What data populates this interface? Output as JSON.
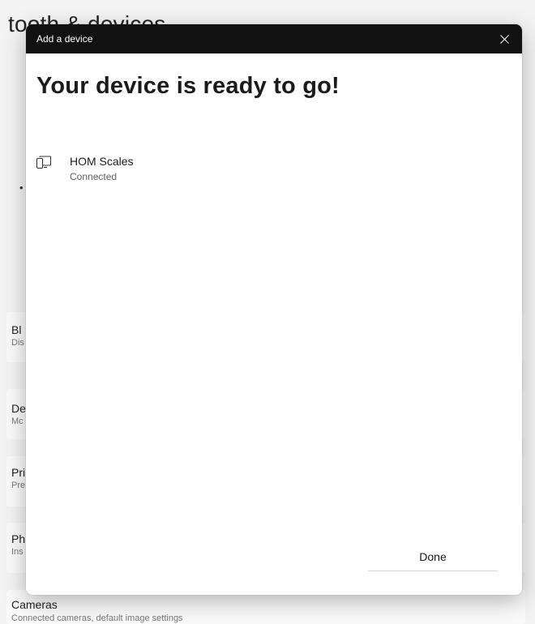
{
  "background": {
    "page_title": "tooth & devices",
    "items": [
      {
        "title": "Bl",
        "subtitle": "Dis"
      },
      {
        "title": "De",
        "subtitle": "Mc"
      },
      {
        "title": "Pri",
        "subtitle": "Pre"
      },
      {
        "title": "Ph",
        "subtitle": "Ins"
      },
      {
        "title": "Cameras",
        "subtitle": "Connected cameras, default image settings"
      }
    ]
  },
  "dialog": {
    "title": "Add a device",
    "heading": "Your device is ready to go!",
    "device": {
      "name": "HOM Scales",
      "status": "Connected",
      "icon": "device-icon"
    },
    "done_label": "Done"
  }
}
